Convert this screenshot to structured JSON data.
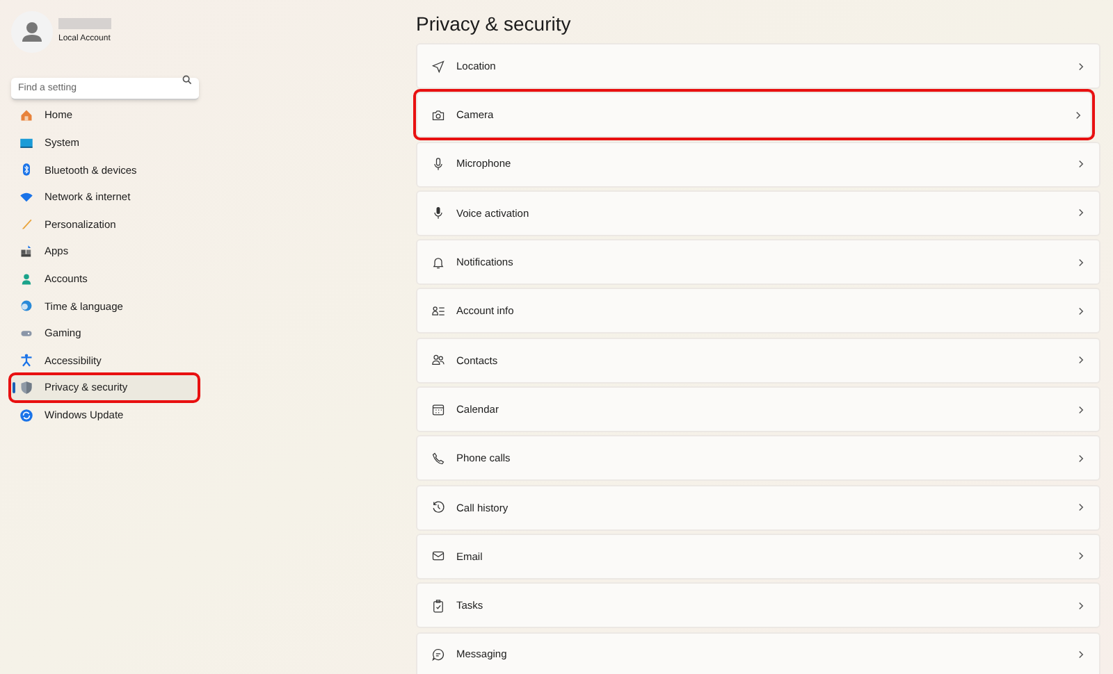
{
  "account": {
    "type": "Local Account"
  },
  "search": {
    "placeholder": "Find a setting"
  },
  "nav": [
    {
      "label": "Home",
      "selected": false,
      "highlighted": false
    },
    {
      "label": "System",
      "selected": false,
      "highlighted": false
    },
    {
      "label": "Bluetooth & devices",
      "selected": false,
      "highlighted": false
    },
    {
      "label": "Network & internet",
      "selected": false,
      "highlighted": false
    },
    {
      "label": "Personalization",
      "selected": false,
      "highlighted": false
    },
    {
      "label": "Apps",
      "selected": false,
      "highlighted": false
    },
    {
      "label": "Accounts",
      "selected": false,
      "highlighted": false
    },
    {
      "label": "Time & language",
      "selected": false,
      "highlighted": false
    },
    {
      "label": "Gaming",
      "selected": false,
      "highlighted": false
    },
    {
      "label": "Accessibility",
      "selected": false,
      "highlighted": false
    },
    {
      "label": "Privacy & security",
      "selected": true,
      "highlighted": true
    },
    {
      "label": "Windows Update",
      "selected": false,
      "highlighted": false
    }
  ],
  "page": {
    "title": "Privacy & security"
  },
  "settings": [
    {
      "label": "Location",
      "highlighted": false
    },
    {
      "label": "Camera",
      "highlighted": true
    },
    {
      "label": "Microphone",
      "highlighted": false
    },
    {
      "label": "Voice activation",
      "highlighted": false
    },
    {
      "label": "Notifications",
      "highlighted": false
    },
    {
      "label": "Account info",
      "highlighted": false
    },
    {
      "label": "Contacts",
      "highlighted": false
    },
    {
      "label": "Calendar",
      "highlighted": false
    },
    {
      "label": "Phone calls",
      "highlighted": false
    },
    {
      "label": "Call history",
      "highlighted": false
    },
    {
      "label": "Email",
      "highlighted": false
    },
    {
      "label": "Tasks",
      "highlighted": false
    },
    {
      "label": "Messaging",
      "highlighted": false
    }
  ]
}
